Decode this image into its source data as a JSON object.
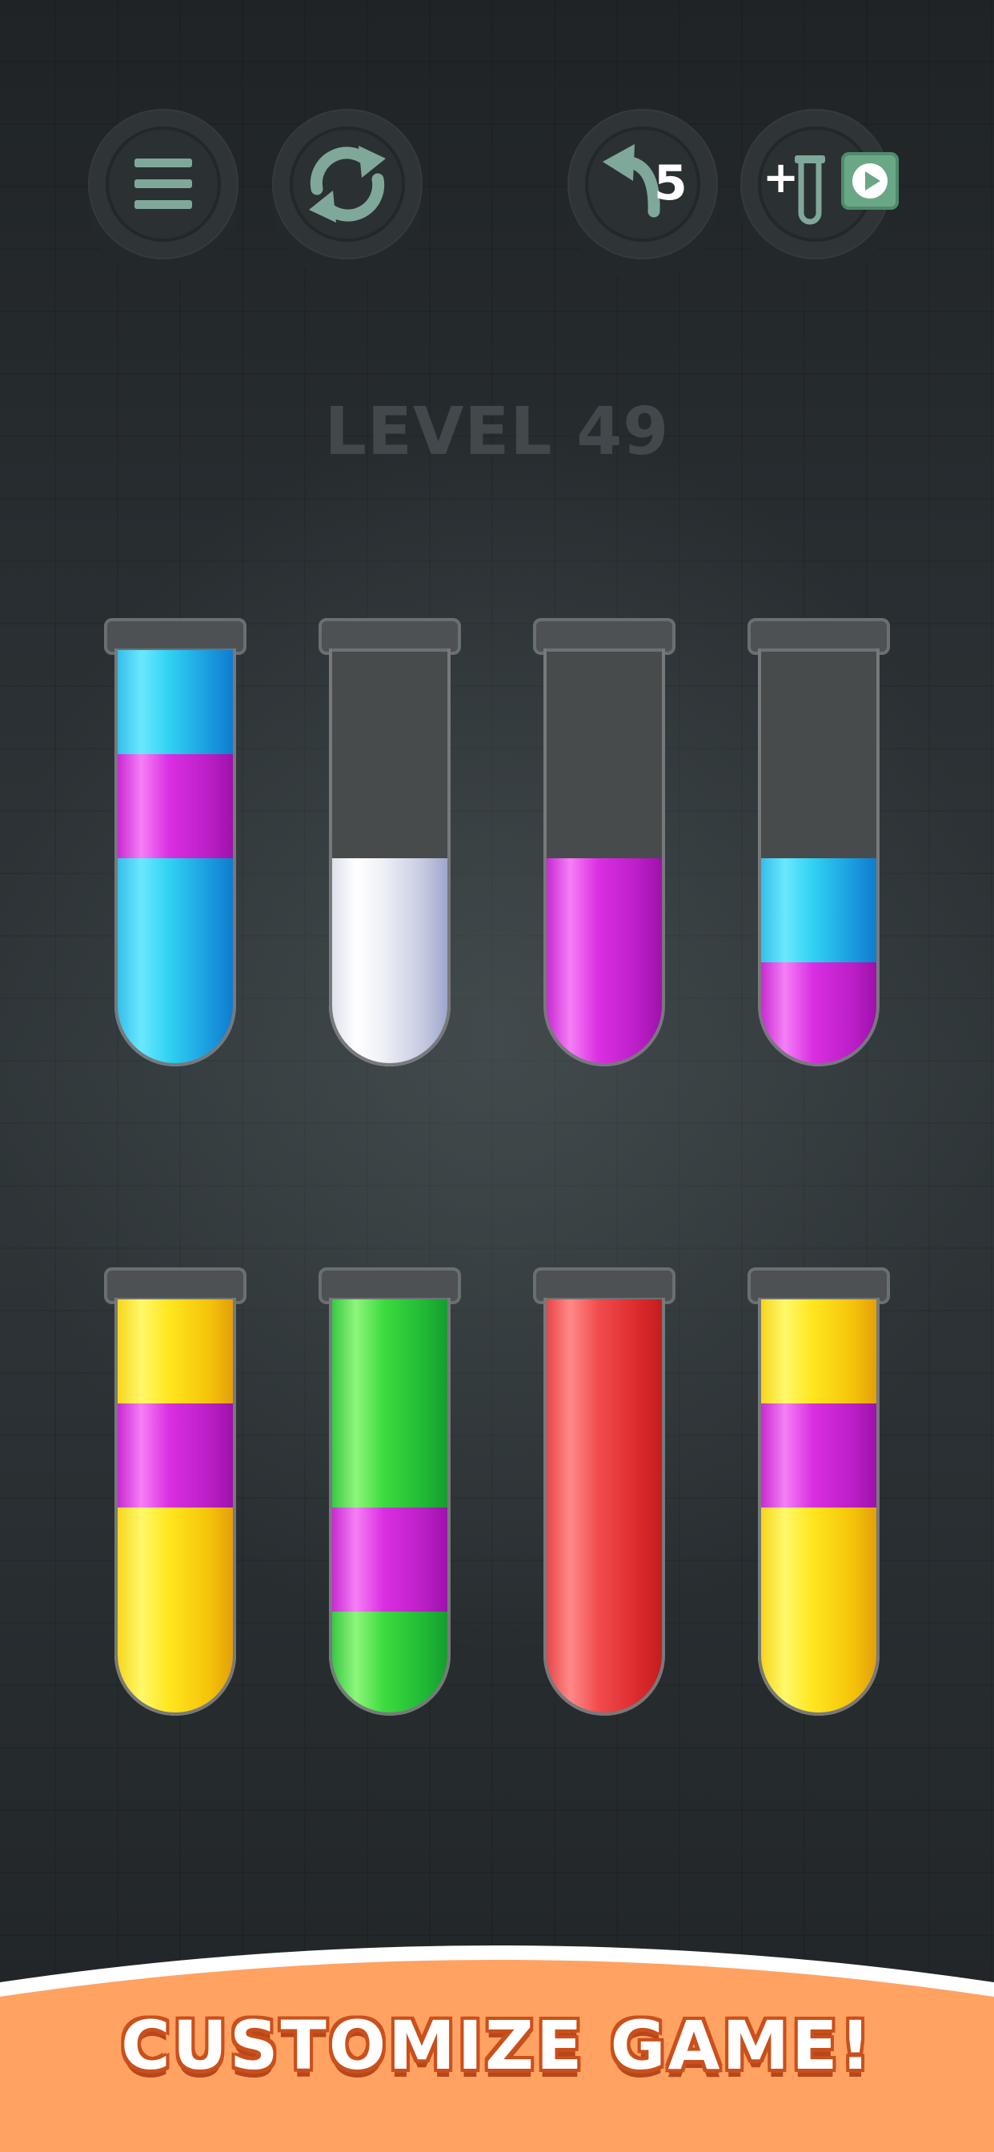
{
  "colors": {
    "icon_color": "#7fa89a",
    "banner_color": "#ffa262",
    "banner_text_outline": "#c9501c",
    "background": "#2b3033"
  },
  "toolbar": {
    "menu_icon": "hamburger-menu-icon",
    "restart_icon": "restart-arrows-icon",
    "undo_icon": "undo-arrow-icon",
    "undo_count": "5",
    "add_tube_plus": "+",
    "add_tube_icon": "test-tube-icon",
    "add_tube_video_icon": "play-video-icon"
  },
  "level": {
    "title": "LEVEL 49"
  },
  "tubes": [
    {
      "segments_bottom_to_top": [
        "cyan",
        "cyan",
        "magenta",
        "cyan"
      ]
    },
    {
      "segments_bottom_to_top": [
        "white",
        "white"
      ]
    },
    {
      "segments_bottom_to_top": [
        "magenta",
        "magenta"
      ]
    },
    {
      "segments_bottom_to_top": [
        "magenta",
        "cyan"
      ]
    },
    {
      "segments_bottom_to_top": [
        "yellow",
        "yellow",
        "magenta",
        "yellow"
      ]
    },
    {
      "segments_bottom_to_top": [
        "green",
        "magenta",
        "green",
        "green"
      ]
    },
    {
      "segments_bottom_to_top": [
        "red",
        "red",
        "red",
        "red"
      ]
    },
    {
      "segments_bottom_to_top": [
        "yellow",
        "yellow",
        "magenta",
        "yellow"
      ]
    }
  ],
  "banner": {
    "text": "CUSTOMIZE GAME!"
  }
}
